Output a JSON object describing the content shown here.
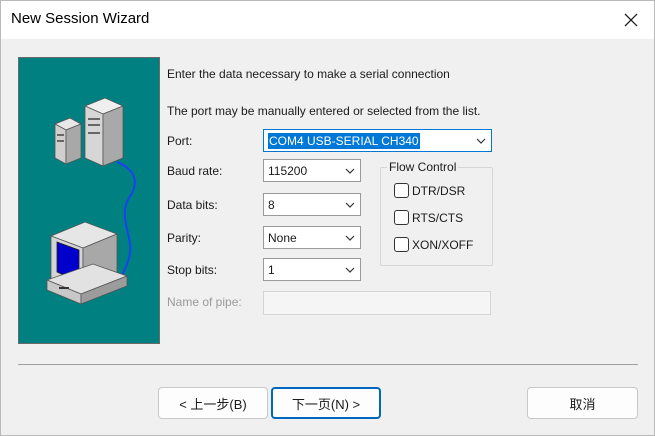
{
  "window": {
    "title": "New Session Wizard"
  },
  "instructions": {
    "line1": "Enter the data necessary to make a serial connection",
    "line2": "The port may be manually entered or selected from the list."
  },
  "fields": {
    "port": {
      "label": "Port:",
      "value": "COM4 USB-SERIAL CH340"
    },
    "baud_rate": {
      "label": "Baud rate:",
      "value": "115200"
    },
    "data_bits": {
      "label": "Data bits:",
      "value": "8"
    },
    "parity": {
      "label": "Parity:",
      "value": "None"
    },
    "stop_bits": {
      "label": "Stop bits:",
      "value": "1"
    },
    "name_of_pipe": {
      "label": "Name of pipe:",
      "value": ""
    }
  },
  "flow_control": {
    "label": "Flow Control",
    "options": [
      {
        "label": "DTR/DSR",
        "checked": false
      },
      {
        "label": "RTS/CTS",
        "checked": false
      },
      {
        "label": "XON/XOFF",
        "checked": false
      }
    ]
  },
  "buttons": {
    "back": "< 上一步(B)",
    "next": "下一页(N) >",
    "cancel": "取消"
  },
  "icons": {
    "close": "close-icon",
    "dropdown": "chevron-down-icon",
    "illustration": "servers-computer-illustration"
  },
  "colors": {
    "illustration_bg": "#008080",
    "accent": "#0078d7"
  }
}
